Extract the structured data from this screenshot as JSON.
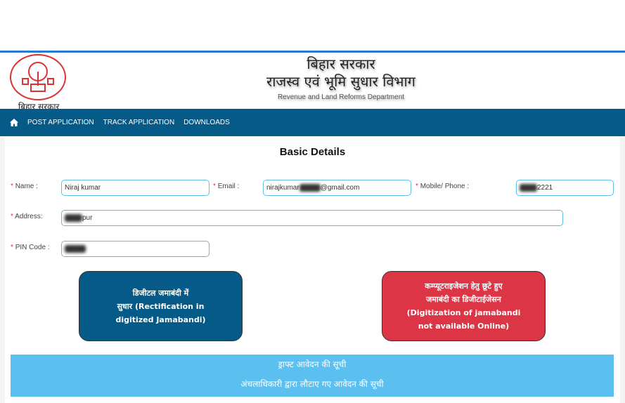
{
  "header": {
    "logo_text": "बिहार सरकार",
    "title1": "बिहार सरकार",
    "title2": "राजस्व एवं भूमि सुधार विभाग",
    "subtitle": "Revenue and Land Reforms Department"
  },
  "nav": {
    "items": [
      {
        "label": "POST APPLICATION"
      },
      {
        "label": "TRACK APPLICATION"
      },
      {
        "label": "DOWNLOADS"
      }
    ]
  },
  "form": {
    "title": "Basic Details",
    "name": {
      "label": "Name :",
      "value": "Niraj kumar"
    },
    "email": {
      "label": "Email :",
      "value_start": "nirajkumar",
      "value_end": "@gmail.com"
    },
    "mobile": {
      "label": "Mobile/ Phone :",
      "value_end": "2221"
    },
    "address": {
      "label": "Address:",
      "value_end": "pur"
    },
    "pin": {
      "label": "PIN Code :"
    }
  },
  "buttons": {
    "rectification": {
      "line1": "डिजीटल जमाबंदी में",
      "line2": "सुधार  (Rectification in",
      "line3": "digitized Jamabandi)"
    },
    "digitization": {
      "line1": "कम्प्यूटराइजेशन हेतु छूटे हुए",
      "line2": "जमाबंदी का डिजीटाईजेसन",
      "line3": "(Digitization of jamabandi",
      "line4": "not available Online)"
    }
  },
  "lists": {
    "draft": "ड्राफ्ट आवेदन की सूची",
    "returned": "अंचलाधिकारी द्वारा लौटाए गए आवेदन की सूची"
  },
  "colors": {
    "nav": "#055a87",
    "danger": "#dc3545",
    "info": "#5bc0f0"
  }
}
